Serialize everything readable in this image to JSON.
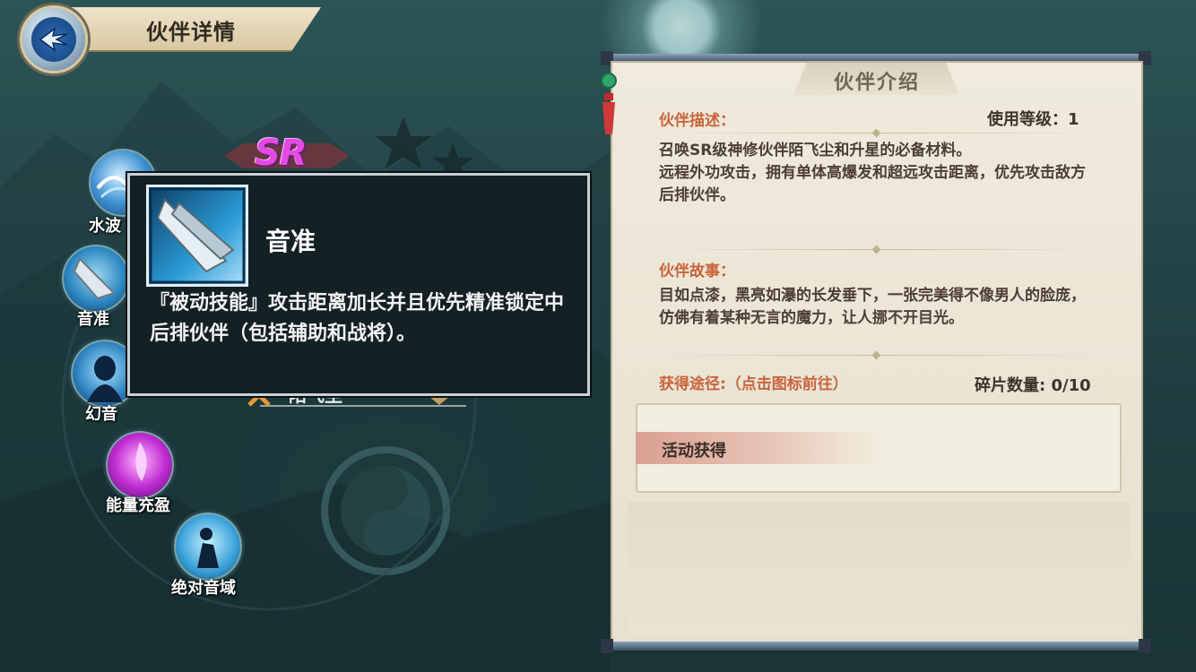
{
  "header": {
    "title": "伙伴详情",
    "back_icon": "back-arrow-icon"
  },
  "badge": {
    "rarity": "SR"
  },
  "skills": [
    {
      "label": "水波",
      "icon": "water-wave-icon"
    },
    {
      "label": "音准",
      "icon": "blade-icon"
    },
    {
      "label": "幻音",
      "icon": "phantom-icon"
    },
    {
      "label": "能量充盈",
      "icon": "energy-icon"
    },
    {
      "label": "绝对音域",
      "icon": "silhouette-icon"
    }
  ],
  "tooltip": {
    "name": "音准",
    "description": "『被动技能』攻击距离加长并且优先精准锁定中后排伙伴（包括辅助和战将）。"
  },
  "partner": {
    "name": "陌飞尘"
  },
  "panel": {
    "title": "伙伴介绍",
    "description_title": "伙伴描述：",
    "level_label": "使用等级：1",
    "description_lines": [
      "召唤SR级神修伙伴陌飞尘和升星的必备材料。",
      "远程外功攻击，拥有单体高爆发和超远攻击距离，优先攻击敌方后排伙伴。"
    ],
    "story_title": "伙伴故事：",
    "story": "目如点漆，黑亮如瀑的长发垂下，一张完美得不像男人的脸庞，仿佛有着某种无言的魔力，让人挪不开目光。",
    "source_title": "获得途径:（点击图标前往）",
    "fragments_label": "碎片数量: 0/10",
    "sources": [
      {
        "label": "活动获得"
      }
    ]
  },
  "colors": {
    "accent_orange": "#c8643a",
    "sr_purple": "#e24be3"
  }
}
